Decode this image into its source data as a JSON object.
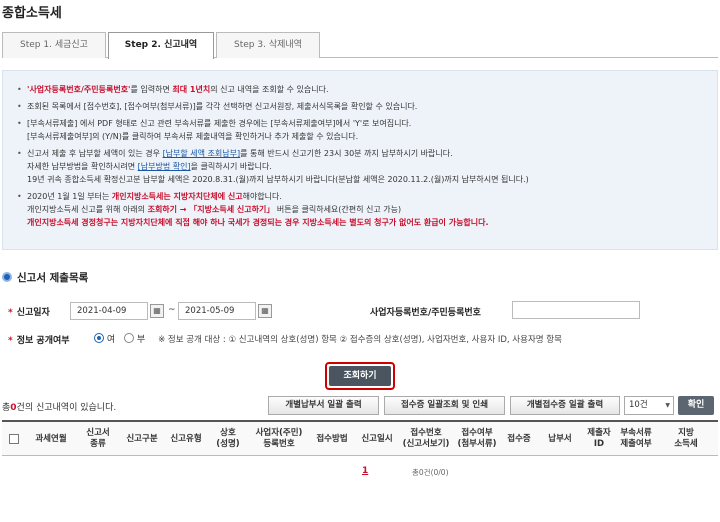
{
  "page_title": "종합소득세",
  "tabs": [
    {
      "label": "Step 1. 세금신고",
      "active": false
    },
    {
      "label": "Step 2. 신고내역",
      "active": true
    },
    {
      "label": "Step 3. 삭제내역",
      "active": false
    }
  ],
  "notice": {
    "n1_a": "'사업자등록번호/주민등록번호'",
    "n1_b": "를 입력하면 ",
    "n1_c": "최대 1년치",
    "n1_d": "의 신고 내역을 조회할 수 있습니다.",
    "n2": "조회된 목록에서 [접수번호], [접수여부(첨부서류)]를 각각 선택하면 신고서원장, 제출서식목록을 확인할 수 있습니다.",
    "n3_1": "[부속서류제출] 에서 PDF 형태로 신고 관련 부속서류를 제출한 경우에는 [부속서류제출여부]에서 'Y'로 보여집니다.",
    "n3_2": "[부속서류제출여부]의 (Y/N)를 클릭하여 부속서류 제출내역을 확인하거나 추가 제출할 수 있습니다.",
    "n4_1a": "신고서 제출 후 납부할 세액이 있는 경우 ",
    "n4_1b": "[납부할 세액 조회납부]",
    "n4_1c": "를 통해 반드시 신고기한 23시 30분 까지 납부하시기 바랍니다.",
    "n4_2a": "자세한 납부방법을 확인하시려면 ",
    "n4_2b": "[납부방법 확인]",
    "n4_2c": "을 클릭하시기 바랍니다.",
    "n4_3": "19년 귀속 종합소득세 확정신고분 납부할 세액은 2020.8.31.(월)까지 납부하시기 바랍니다(분납할 세액은 2020.11.2.(월)까지 납부하시면 됩니다.)",
    "n5_1a": "2020년 1월 1일 부터는 ",
    "n5_1b": "개인지방소득세는 지방자치단체에 신고",
    "n5_1c": "해야합니다.",
    "n5_2a": "개인지방소득세 신고를 위해 아래의 ",
    "n5_2b": "조회하기 → 「지방소득세 신고하기」",
    "n5_2c": " 버튼을 클릭하세요(간편히 신고 가능)",
    "n5_3": "개인지방소득세 경정청구는 지방자치단체에 직접 해야 하나 국세가 경정되는 경우 지방소득세는 별도의 청구가 없어도 환급이 가능합니다."
  },
  "section_title": "신고서 제출목록",
  "form": {
    "date_label": "신고일자",
    "date_from": "2021-04-09",
    "date_to": "2021-05-09",
    "tilde": "~",
    "bizno_label": "사업자등록번호/주민등록번호",
    "disclose_label": "정보 공개여부",
    "opt_yes": "여",
    "opt_no": "부",
    "disclose_note": "※ 정보 공개 대상 : ① 신고내역의 상호(성명) 항목 ② 접수증의 상호(성명), 사업자번호, 사용자 ID, 사용자명 항목"
  },
  "search_button": "조회하기",
  "results": {
    "count_prefix": "총",
    "count": "0",
    "count_suffix": "건의 신고내역이 있습니다.",
    "btn_bulk_print": "개별납부서 일괄 출력",
    "btn_receipt_bulk": "접수증 일괄조회 및 인쇄",
    "btn_indiv_receipt": "개별접수증 일괄 출력",
    "page_size": "10건",
    "btn_confirm": "확인"
  },
  "table_headers": [
    "과세연월",
    "신고서\n종류",
    "신고구분",
    "신고유형",
    "상호\n(성명)",
    "사업자(주민)\n등록번호",
    "접수방법",
    "신고일시",
    "접수번호\n(신고서보기)",
    "접수여부\n(첨부서류)",
    "접수증",
    "납부서",
    "제출자\nID",
    "부속서류\n제출여부",
    "지방\n소득세"
  ],
  "pager": {
    "page": "1",
    "total": "총0건(0/0)"
  }
}
